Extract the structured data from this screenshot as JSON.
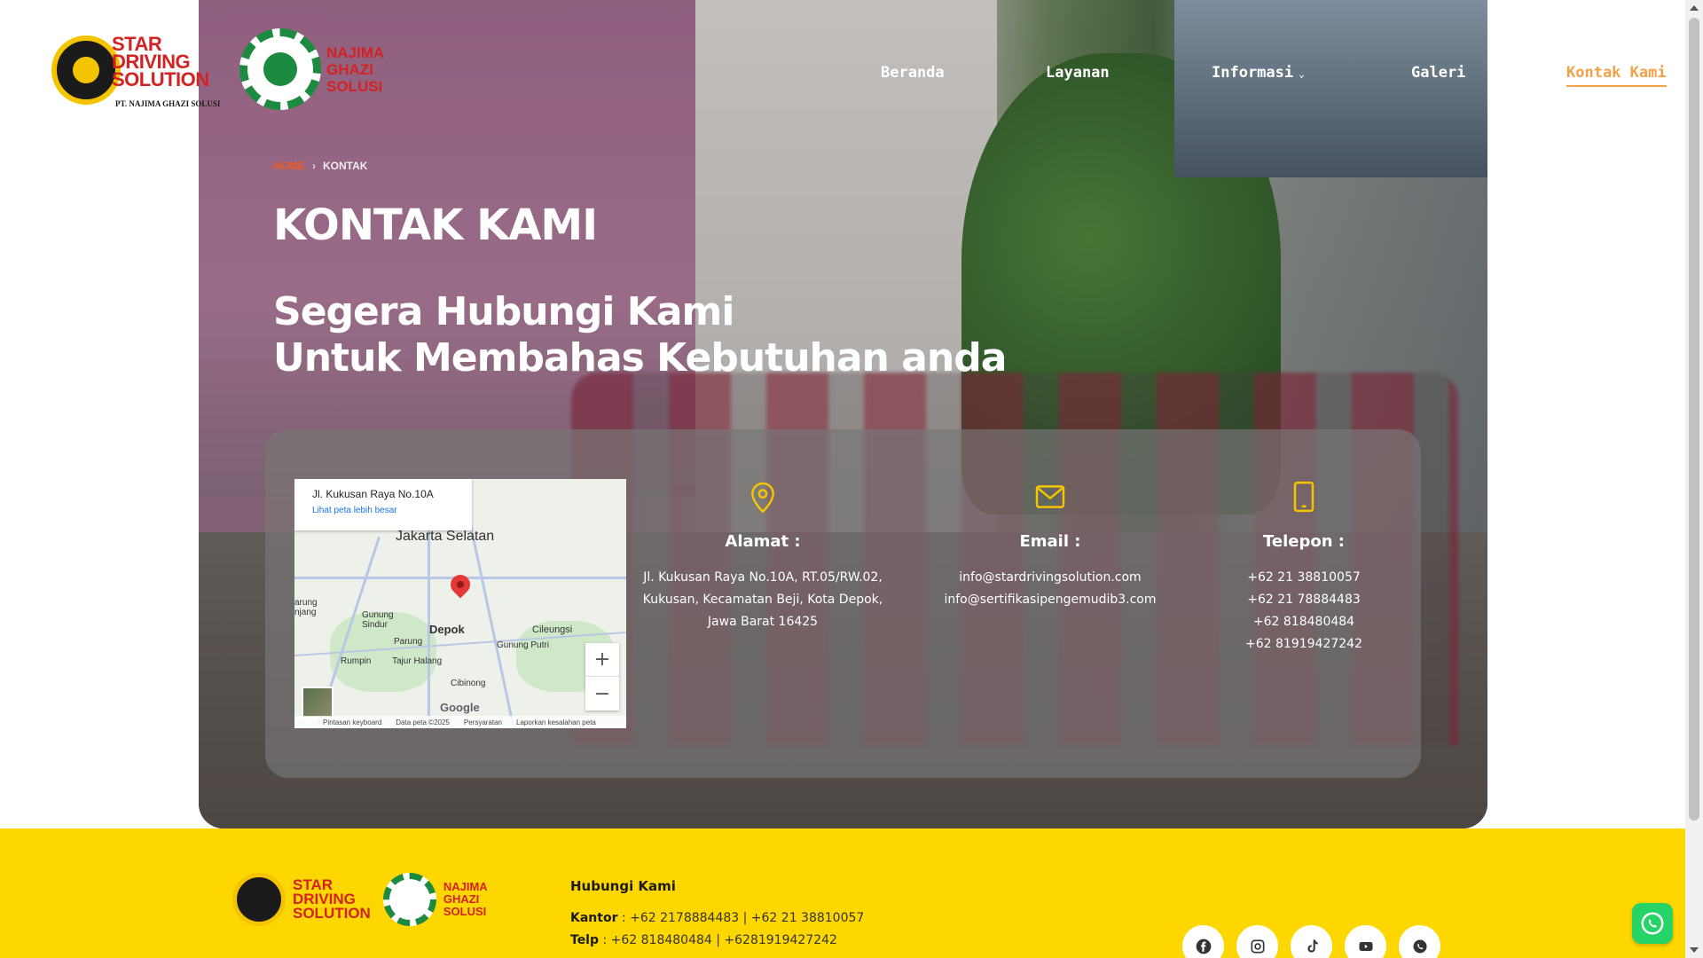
{
  "header": {
    "logo_primary": {
      "line1": "STAR",
      "line2": "DRIVING",
      "line3": "SOLUTION",
      "sub": "PT. NAJIMA GHAZI SOLUSI"
    },
    "logo_secondary": {
      "line1": "NAJIMA",
      "line2": "GHAZI",
      "line3": "SOLUSI"
    },
    "nav": [
      {
        "label": "Beranda"
      },
      {
        "label": "Layanan"
      },
      {
        "label": "Informasi"
      },
      {
        "label": "Galeri"
      },
      {
        "label": "Kontak Kami"
      }
    ],
    "active_color": "#f3a24a"
  },
  "hero": {
    "breadcrumb": {
      "home": "Home",
      "current": "Kontak"
    },
    "title": "KONTAK KAMI",
    "headline_line1": "Segera Hubungi Kami",
    "headline_line2": "Untuk Membahas Kebutuhan anda"
  },
  "map": {
    "place": "Jl. Kukusan Raya No.10A",
    "larger_map_link": "Lihat peta lebih besar",
    "labels": {
      "jakarta": "Jakarta Selatan",
      "depok": "Depok",
      "gunung_sindur": "Gunung Sindur",
      "parung": "Parung",
      "rumpin": "Rumpin",
      "tajur": "Tajur Halang",
      "cibinong": "Cibinong",
      "cileungsi": "Cileungsi",
      "gunung_putri": "Gunung Putri",
      "left_edge": "arung njang"
    },
    "zoom_in": "+",
    "zoom_out": "−",
    "brand": "Google",
    "footer": [
      "Pintasan keyboard",
      "Data peta ©2025",
      "Persyaratan",
      "Laporkan kesalahan peta"
    ]
  },
  "contact": {
    "address": {
      "heading": "Alamat :",
      "lines": [
        "Jl. Kukusan Raya No.10A, RT.05/RW.02,",
        "Kukusan, Kecamatan Beji, Kota Depok,",
        "Jawa Barat 16425"
      ]
    },
    "email": {
      "heading": "Email :",
      "lines": [
        "info@stardrivingsolution.com",
        "info@sertifikasipengemudib3.com"
      ]
    },
    "phone": {
      "heading": "Telepon :",
      "lines": [
        "+62 21 38810057",
        "+62 21 78884483",
        "+62 818480484",
        "+62 81919427242"
      ]
    },
    "icon_color": "#f5c400"
  },
  "footer": {
    "heading": "Hubungi Kami",
    "kantor_label": "Kantor",
    "kantor_value": " : +62 2178884483 | +62 21 38810057",
    "telp_label": "Telp",
    "telp_value": " : +62 818480484 | +6281919427242",
    "socials": [
      "facebook-icon",
      "instagram-icon",
      "tiktok-icon",
      "youtube-icon",
      "whatsapp-icon"
    ],
    "background": "#ffd700"
  }
}
